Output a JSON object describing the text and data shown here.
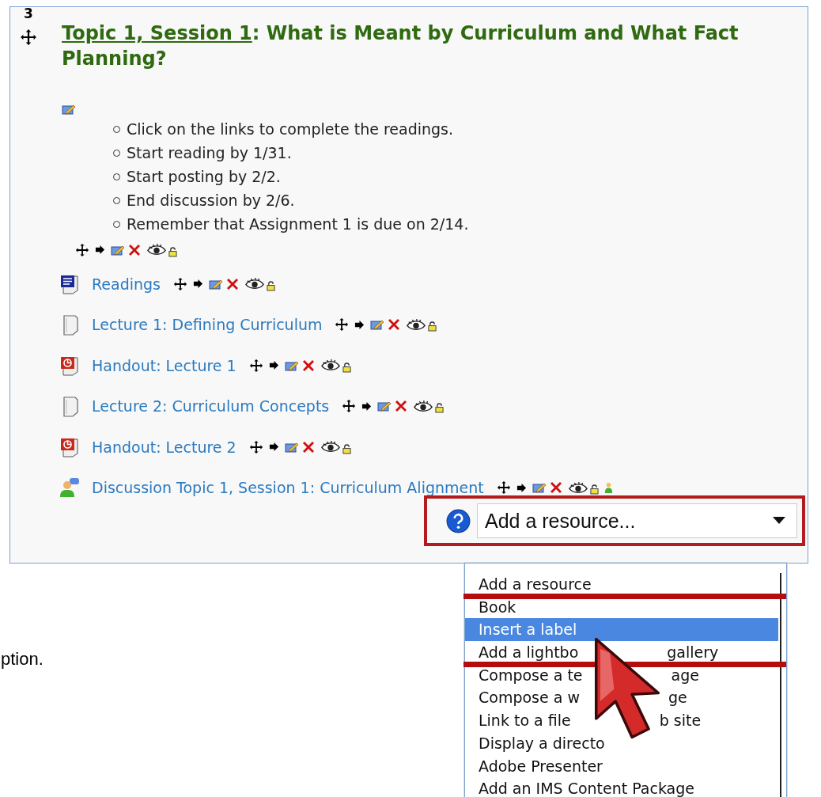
{
  "section": {
    "number": "3",
    "title_link": "Topic 1, Session 1",
    "title_rest": ": What is Meant by Curriculum and What Fact",
    "title_line2": "Planning?",
    "summary": [
      "Click on the links to complete the readings.",
      "Start reading by 1/31.",
      "Start posting by 2/2.",
      "End discussion by 2/6.",
      "Remember that Assignment 1 is due on 2/14."
    ],
    "resources": [
      {
        "kind": "word",
        "title": "Readings"
      },
      {
        "kind": "file",
        "title": "Lecture 1: Defining Curriculum"
      },
      {
        "kind": "powerpoint",
        "title": "Handout: Lecture 1"
      },
      {
        "kind": "file",
        "title": "Lecture 2: Curriculum Concepts"
      },
      {
        "kind": "powerpoint",
        "title": "Handout: Lecture 2"
      },
      {
        "kind": "forum",
        "title": "Discussion Topic 1, Session 1: Curriculum Alignment"
      }
    ],
    "add_resource": {
      "value": "Add a resource..."
    }
  },
  "page_text": "ption.",
  "dropdown": {
    "options": [
      {
        "parts": [
          "Add a resource"
        ],
        "selected": false
      },
      {
        "parts": [
          "Book"
        ],
        "selected": false
      },
      {
        "parts": [
          "Insert a label"
        ],
        "selected": true
      },
      {
        "parts": [
          "Add a lightbo",
          "gallery"
        ],
        "selected": false
      },
      {
        "parts": [
          "Compose a te",
          "age"
        ],
        "selected": false
      },
      {
        "parts": [
          "Compose a w",
          "ge"
        ],
        "selected": false
      },
      {
        "parts": [
          "Link to a file",
          "b site"
        ],
        "selected": false
      },
      {
        "parts": [
          "Display a directo"
        ],
        "selected": false
      },
      {
        "parts": [
          "Adobe Presenter"
        ],
        "selected": false
      },
      {
        "parts": [
          "Add an IMS Content Package"
        ],
        "selected": false
      }
    ]
  }
}
